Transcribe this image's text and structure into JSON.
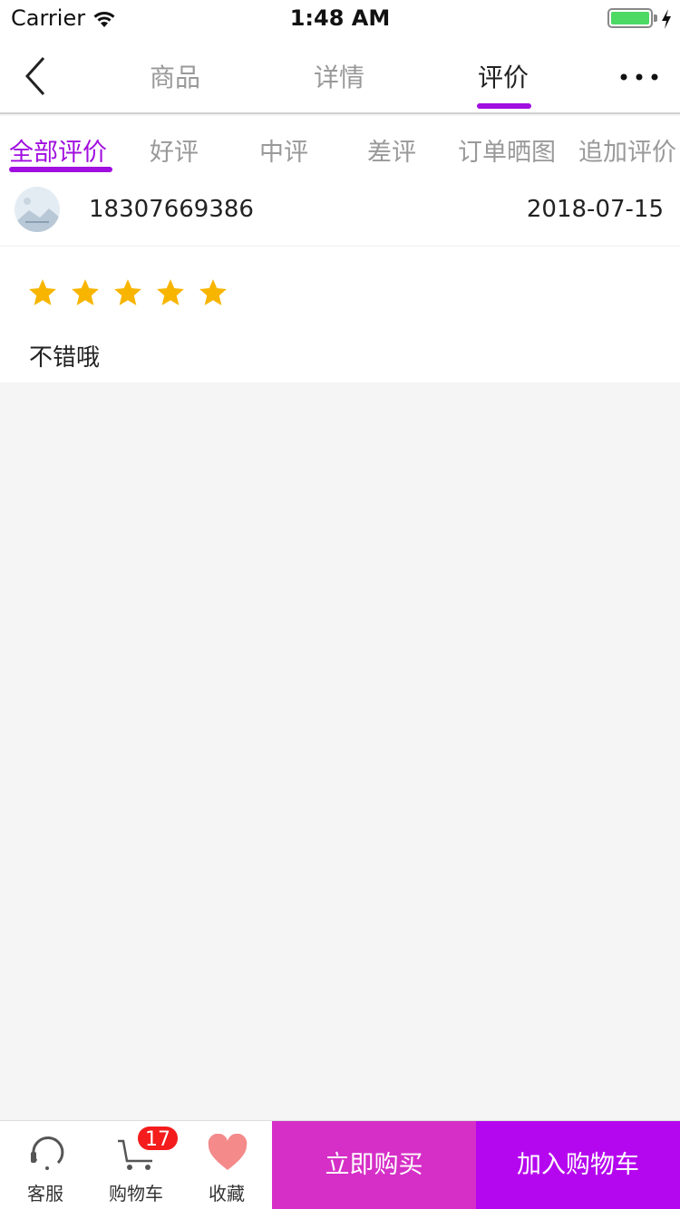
{
  "status_bar": {
    "carrier": "Carrier",
    "time": "1:48 AM",
    "battery_level": 1.0,
    "battery_color": "#4cd964"
  },
  "nav": {
    "back_icon": "chevron-left-icon",
    "tabs": [
      {
        "label": "商品",
        "active": false
      },
      {
        "label": "详情",
        "active": false
      },
      {
        "label": "评价",
        "active": true
      }
    ],
    "more_icon": "more-horizontal-icon",
    "accent": "#a10ee0"
  },
  "filters": [
    {
      "label": "全部评价",
      "active": true
    },
    {
      "label": "好评",
      "active": false
    },
    {
      "label": "中评",
      "active": false
    },
    {
      "label": "差评",
      "active": false
    },
    {
      "label": "订单晒图",
      "active": false
    },
    {
      "label": "追加评价",
      "active": false
    }
  ],
  "review": {
    "avatar_icon": "image-placeholder-icon",
    "user": "18307669386",
    "date": "2018-07-15",
    "rating": 5,
    "rating_max": 5,
    "text": "不错哦",
    "star_color": "#f7b500"
  },
  "bottom_bar": {
    "items": [
      {
        "label": "客服",
        "icon": "headset-icon"
      },
      {
        "label": "购物车",
        "icon": "cart-icon",
        "badge": "17"
      },
      {
        "label": "收藏",
        "icon": "heart-icon"
      }
    ],
    "buy_now": "立即购买",
    "add_to_cart": "加入购物车",
    "buy_color": "#d52fc7",
    "cart_color": "#b507ef",
    "badge_color": "#f41c1c"
  }
}
